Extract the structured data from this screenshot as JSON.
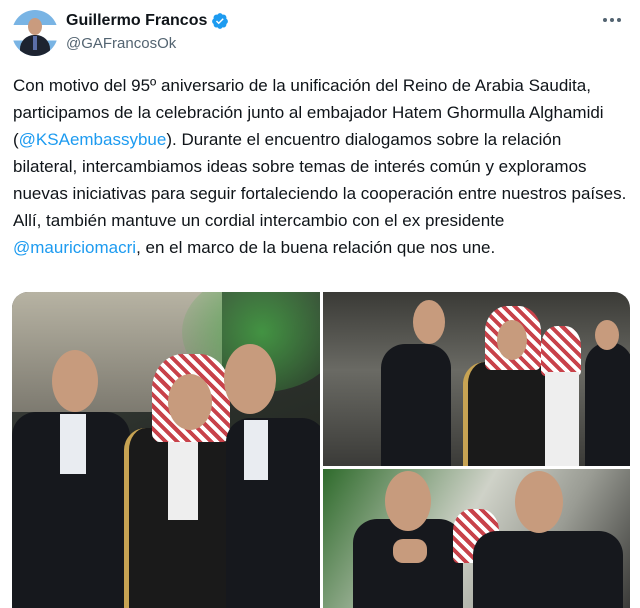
{
  "author": {
    "display_name": "Guillermo Francos",
    "handle": "@GAFrancosOk",
    "verified": true,
    "verified_color": "#1d9bf0"
  },
  "tweet": {
    "part1": "Con motivo del 95º aniversario de la unificación del Reino de Arabia Saudita, participamos de la celebración junto al embajador Hatem Ghormulla Alghamidi (",
    "mention1": "@KSAembassybue",
    "part2": "). Durante el encuentro dialogamos sobre la relación bilateral, intercambiamos ideas sobre temas de interés común y exploramos nuevas iniciativas para seguir fortaleciendo la cooperación entre nuestros países.\nAllí, también mantuve un cordial intercambio con el ex presidente ",
    "mention2": "@mauriciomacri",
    "part3": ", en el marco de la buena relación que nos une."
  },
  "colors": {
    "text": "#0f1419",
    "secondary": "#536471",
    "link": "#1d9bf0"
  },
  "media": {
    "count": 3
  }
}
